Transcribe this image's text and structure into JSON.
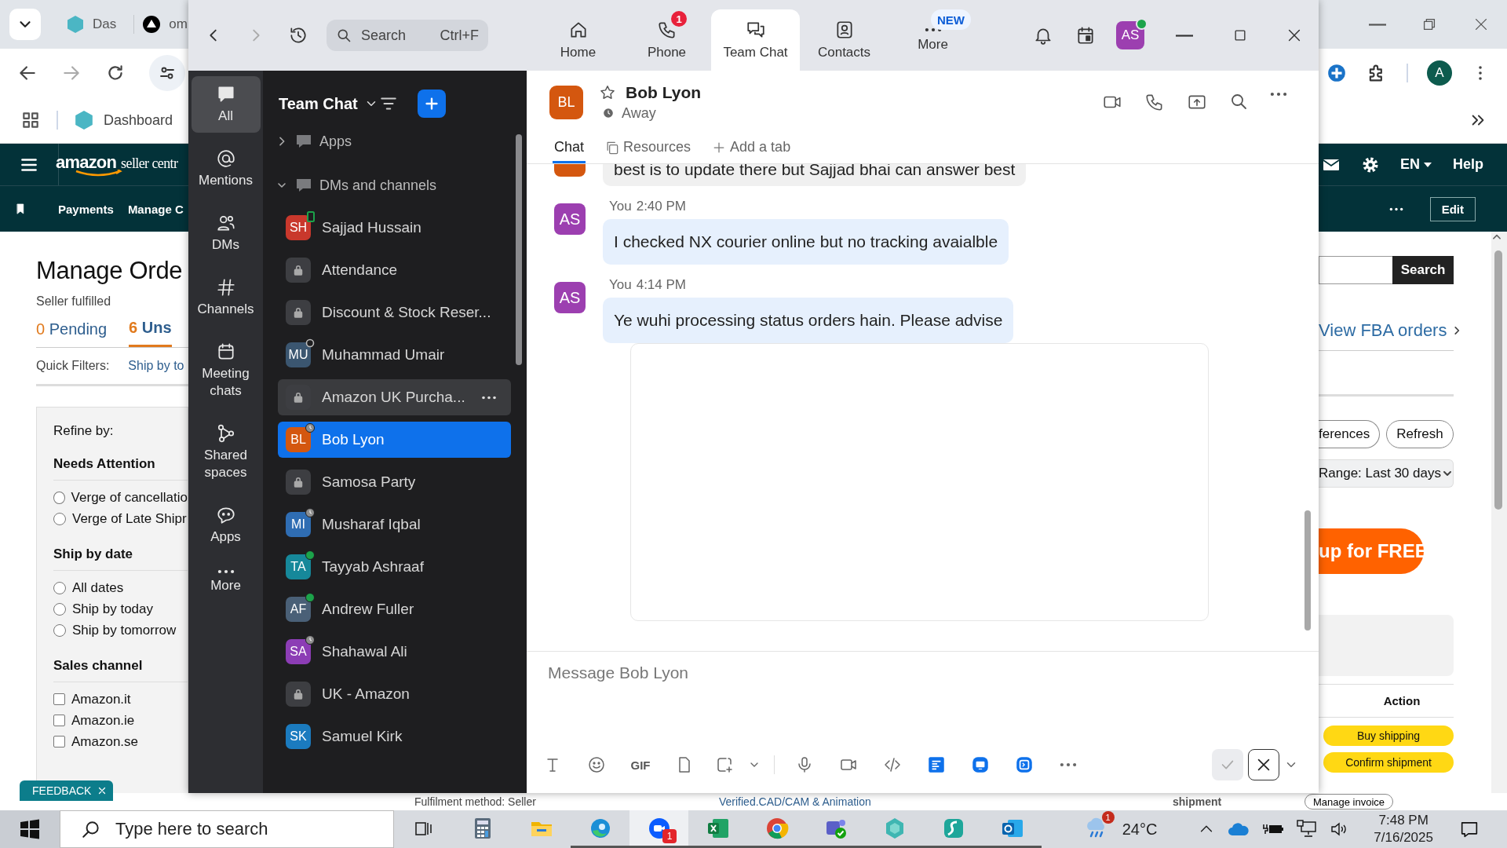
{
  "browser": {
    "tabs": [
      {
        "label": "Das",
        "kind": "hexagon"
      },
      {
        "label": "om",
        "kind": "triangle"
      }
    ],
    "bookmarks": [
      {
        "label": "Dashboard"
      }
    ],
    "profile": "A"
  },
  "amazon": {
    "logo": "amazon",
    "logo_sub": "seller centr",
    "language": "EN",
    "help": "Help",
    "subnav": [
      "Payments",
      "Manage C"
    ],
    "edit": "Edit",
    "title": "Manage Orde",
    "subtitle": "Seller fulfilled",
    "order_tabs": [
      {
        "count": "0",
        "label": "Pending",
        "selected": false
      },
      {
        "count": "6",
        "label": "Uns",
        "selected": true
      }
    ],
    "quick_filters": {
      "label": "Quick Filters:",
      "link": "Ship by to"
    },
    "refine": {
      "title": "Refine by:",
      "groups": [
        {
          "title": "Needs Attention",
          "kind": "radio",
          "options": [
            {
              "label": "Verge of cancellatio",
              "checked": false
            },
            {
              "label": "Verge of Late Shipr",
              "checked": false
            }
          ]
        },
        {
          "title": "Ship by date",
          "kind": "radio",
          "options": [
            {
              "label": "All dates",
              "checked": false
            },
            {
              "label": "Ship by today",
              "checked": false
            },
            {
              "label": "Ship by tomorrow",
              "checked": false
            }
          ]
        },
        {
          "title": "Sales channel",
          "kind": "checkbox",
          "options": [
            {
              "label": "Amazon.it",
              "checked": false
            },
            {
              "label": "Amazon.ie",
              "checked": false
            },
            {
              "label": "Amazon.se",
              "checked": false
            }
          ]
        }
      ]
    },
    "search_button": "Search",
    "fba_link": "View FBA orders",
    "buttons": [
      "ferences",
      "Refresh"
    ],
    "range": "Range: Last 30 days",
    "promo": "up for FREE",
    "table_header": "Action",
    "actions": [
      "Buy shipping",
      "Confirm shipment"
    ],
    "footer": [
      "Fulfilment method: Seller",
      "Verified.CAD/CAM & Animation",
      "shipment"
    ],
    "manage_invoice": "Manage invoice",
    "feedback": "FEEDBACK"
  },
  "zoom": {
    "search": {
      "placeholder": "Search",
      "shortcut": "Ctrl+F"
    },
    "tabs": [
      {
        "label": "Home",
        "kind": "home",
        "selected": false
      },
      {
        "label": "Phone",
        "kind": "phone",
        "badge": "1",
        "selected": false
      },
      {
        "label": "Team Chat",
        "kind": "chat",
        "selected": true
      },
      {
        "label": "Contacts",
        "kind": "contacts",
        "selected": false
      },
      {
        "label": "More",
        "kind": "more",
        "badge": "NEW",
        "selected": false
      }
    ],
    "user": {
      "initials": "AS",
      "color": "#9c3fb0",
      "online": true
    },
    "rail": [
      {
        "label": "All",
        "kind": "all",
        "selected": true
      },
      {
        "label": "Mentions",
        "kind": "mentions",
        "selected": false
      },
      {
        "label": "DMs",
        "kind": "dms",
        "selected": false
      },
      {
        "label": "Channels",
        "kind": "channels",
        "selected": false
      },
      {
        "label": "Meeting chats",
        "kind": "meetings",
        "selected": false
      },
      {
        "label": "Shared spaces",
        "kind": "shared",
        "selected": false
      },
      {
        "label": "Apps",
        "kind": "apps",
        "selected": false
      },
      {
        "label": "More",
        "kind": "more",
        "selected": false
      }
    ],
    "list": {
      "title": "Team Chat",
      "sections": [
        {
          "label": "Apps",
          "expanded": false
        },
        {
          "label": "DMs and channels",
          "expanded": true
        }
      ],
      "items": [
        {
          "name": "Sajjad Hussain",
          "kind": "person",
          "initials": "SH",
          "color": "#c9382c",
          "presence": {
            "kind": "mobile"
          },
          "selected": false,
          "hovered": false
        },
        {
          "name": "Attendance",
          "kind": "channel",
          "selected": false,
          "hovered": false
        },
        {
          "name": "Discount & Stock Reser...",
          "kind": "channel",
          "selected": false,
          "hovered": false
        },
        {
          "name": "Muhammad Umair",
          "kind": "person",
          "initials": "MU",
          "color": "#3b5670",
          "presence": {
            "kind": "offline"
          },
          "selected": false,
          "hovered": false
        },
        {
          "name": "Amazon UK Purcha...",
          "kind": "channel",
          "selected": false,
          "hovered": true
        },
        {
          "name": "Bob Lyon",
          "kind": "person",
          "initials": "BL",
          "color": "#d4570f",
          "presence": {
            "kind": "away"
          },
          "selected": true,
          "hovered": false
        },
        {
          "name": "Samosa Party",
          "kind": "channel",
          "selected": false,
          "hovered": false
        },
        {
          "name": "Musharaf Iqbal",
          "kind": "person",
          "initials": "MI",
          "color": "#2f6db3",
          "presence": {
            "kind": "away"
          },
          "selected": false,
          "hovered": false
        },
        {
          "name": "Tayyab Ashraaf",
          "kind": "person",
          "initials": "TA",
          "color": "#16889a",
          "presence": {
            "kind": "online"
          },
          "selected": false,
          "hovered": false
        },
        {
          "name": "Andrew Fuller",
          "kind": "person",
          "initials": "AF",
          "color": "#4a6077",
          "presence": {
            "kind": "online"
          },
          "selected": false,
          "hovered": false
        },
        {
          "name": "Shahawal Ali",
          "kind": "person",
          "initials": "SA",
          "color": "#8c3db5",
          "presence": {
            "kind": "away"
          },
          "selected": false,
          "hovered": false
        },
        {
          "name": "UK - Amazon",
          "kind": "channel",
          "selected": false,
          "hovered": false
        },
        {
          "name": "Samuel Kirk",
          "kind": "person",
          "initials": "SK",
          "color": "#1b7bbf",
          "selected": false,
          "hovered": false
        }
      ]
    },
    "chat": {
      "contact": {
        "initials": "BL",
        "color": "#d4570f",
        "name": "Bob Lyon",
        "status": "Away"
      },
      "tabs": [
        {
          "label": "Chat",
          "kind": "plain",
          "selected": true
        },
        {
          "label": "Resources",
          "kind": "resources",
          "selected": false
        },
        {
          "label": "Add a tab",
          "kind": "add",
          "selected": false
        }
      ],
      "messages": [
        {
          "kind": "partial",
          "color": "#d4570f",
          "text": "best is to update there but Sajjad bhai can answer best"
        },
        {
          "kind": "full",
          "sender": "You",
          "time": "2:40 PM",
          "initials": "AS",
          "color": "#9c3fb0",
          "text": "I checked NX courier online but no tracking avaialble"
        },
        {
          "kind": "full",
          "sender": "You",
          "time": "4:14 PM",
          "initials": "AS",
          "color": "#9c3fb0",
          "text": "Ye wuhi processing status orders hain. Please advise"
        }
      ],
      "compose": {
        "placeholder": "Message Bob Lyon",
        "gif": "GIF"
      }
    }
  },
  "taskbar": {
    "search": {
      "placeholder": "Type here to search"
    },
    "apps": [
      {
        "kind": "calculator",
        "active": false,
        "running": false
      },
      {
        "kind": "explorer",
        "active": false,
        "running": false
      },
      {
        "kind": "edge",
        "active": false,
        "running": true
      },
      {
        "kind": "zoom",
        "active": true,
        "running": true,
        "badge": "1"
      },
      {
        "kind": "excel",
        "active": false,
        "running": true
      },
      {
        "kind": "chrome",
        "active": false,
        "running": true
      },
      {
        "kind": "teams",
        "active": false,
        "running": true
      },
      {
        "kind": "hexagon",
        "active": false,
        "running": true
      },
      {
        "kind": "surfshark",
        "active": false,
        "running": true
      },
      {
        "kind": "outlook",
        "active": false,
        "running": true
      }
    ],
    "weather_badge": "1",
    "temperature": "24°C",
    "time": "7:48 PM",
    "date": "7/16/2025"
  }
}
